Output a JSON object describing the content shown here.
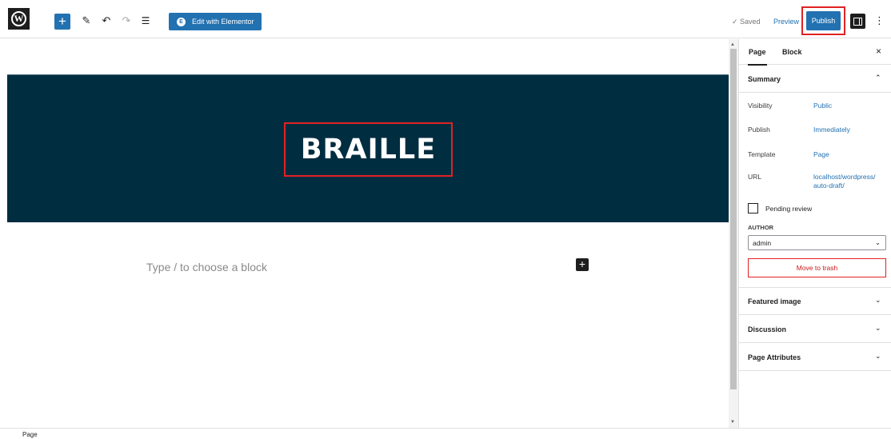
{
  "toolbar": {
    "logo_glyph": "W",
    "inserter_glyph": "+",
    "tools_glyph": "✎",
    "undo_glyph": "↶",
    "redo_glyph": "↷",
    "list_view_glyph": "☰",
    "elementor_badge": "E",
    "elementor_label": "Edit with Elementor",
    "saved_label": "✓ Saved",
    "preview_label": "Preview",
    "publish_label": "Publish",
    "options_glyph": "⋮"
  },
  "canvas": {
    "title": "BRAILLE",
    "block_placeholder": "Type / to choose a block",
    "add_block_glyph": "+",
    "scroll_up_glyph": "▲",
    "scroll_down_glyph": "▼"
  },
  "sidebar": {
    "tabs": [
      {
        "label": "Page"
      },
      {
        "label": "Block"
      }
    ],
    "close_glyph": "×",
    "summary": {
      "title": "Summary",
      "chevron": "⌃",
      "rows": [
        {
          "label": "Visibility",
          "value": "Public"
        },
        {
          "label": "Publish",
          "value": "Immediately"
        },
        {
          "label": "Template",
          "value": "Page"
        },
        {
          "label": "URL",
          "value": "localhost/wordpress/\nauto-draft/"
        }
      ],
      "pending_label": "Pending review",
      "author_label": "AUTHOR",
      "author_value": "admin",
      "select_chevron": "⌄",
      "trash_label": "Move to trash"
    },
    "panels": [
      {
        "title": "Featured image",
        "chevron": "⌄"
      },
      {
        "title": "Discussion",
        "chevron": "⌄"
      },
      {
        "title": "Page Attributes",
        "chevron": "⌄"
      }
    ]
  },
  "statusbar": {
    "breadcrumb": "Page"
  },
  "colors": {
    "accent": "#2271b1",
    "hero_bg": "#002d40",
    "highlight": "#e02323"
  }
}
